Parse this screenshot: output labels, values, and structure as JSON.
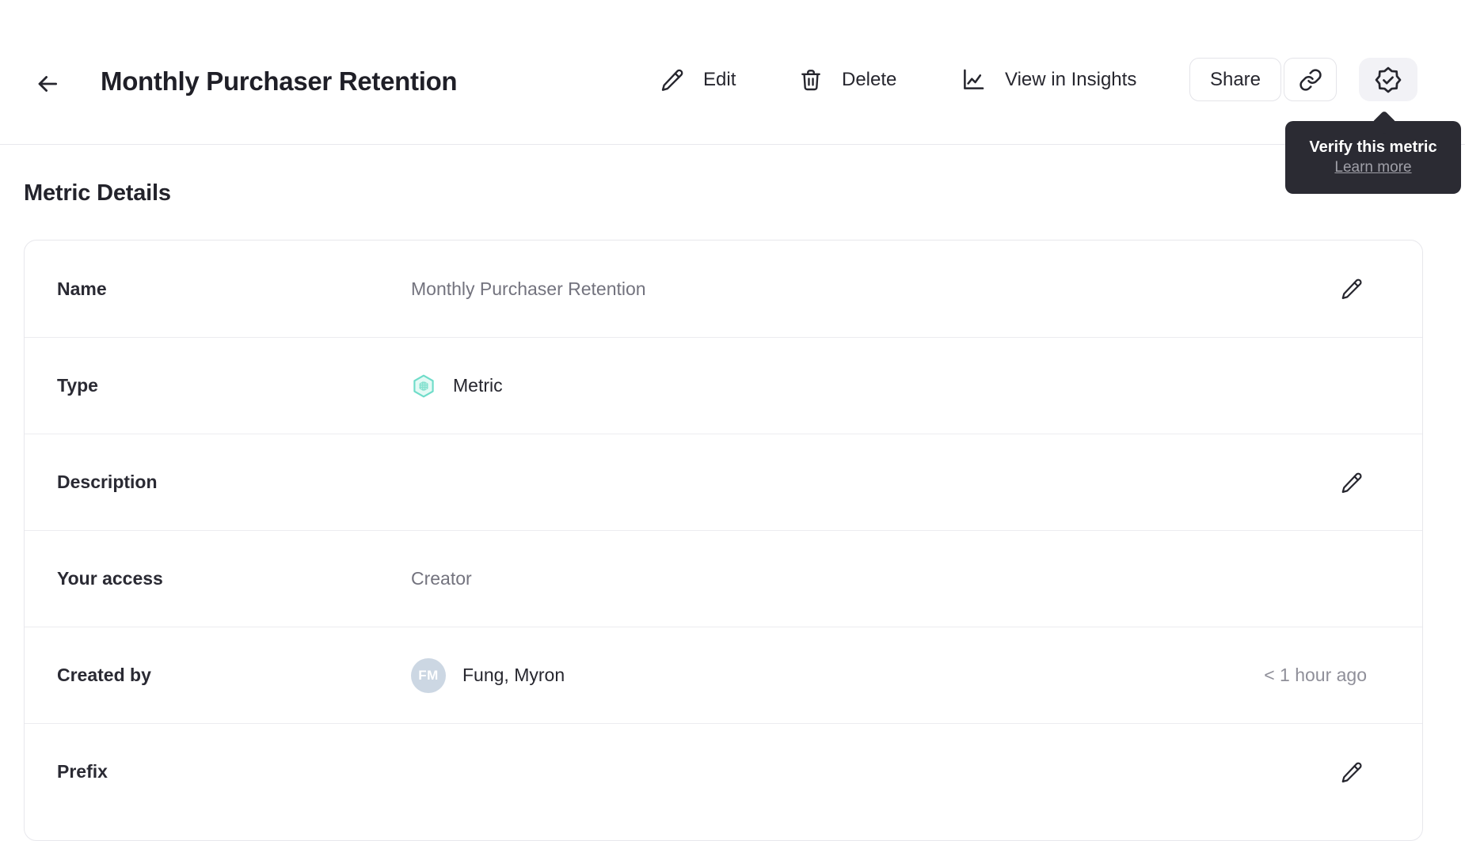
{
  "header": {
    "title": "Monthly Purchaser Retention",
    "actions": {
      "edit": "Edit",
      "delete": "Delete",
      "insights": "View in Insights",
      "share": "Share"
    }
  },
  "tooltip": {
    "title": "Verify this metric",
    "link_label": "Learn more"
  },
  "section": {
    "title": "Metric Details"
  },
  "details": {
    "rows": [
      {
        "label": "Name",
        "value": "Monthly Purchaser Retention"
      },
      {
        "label": "Type",
        "value": "Metric",
        "icon": "metric-hexagon-icon"
      },
      {
        "label": "Description",
        "value": ""
      },
      {
        "label": "Your access",
        "value": "Creator"
      },
      {
        "label": "Created by",
        "value": "Fung, Myron",
        "avatar_initials": "FM",
        "meta": "< 1 hour ago"
      },
      {
        "label": "Prefix",
        "value": ""
      }
    ]
  },
  "colors": {
    "accent_teal_stroke": "#6fdcc9",
    "accent_teal_fill": "#e4faf5",
    "accent_teal_inner": "#84e1cf",
    "avatar_bg": "#ccd7e3",
    "tooltip_bg": "#2b2b33",
    "divider": "#ececf0"
  }
}
